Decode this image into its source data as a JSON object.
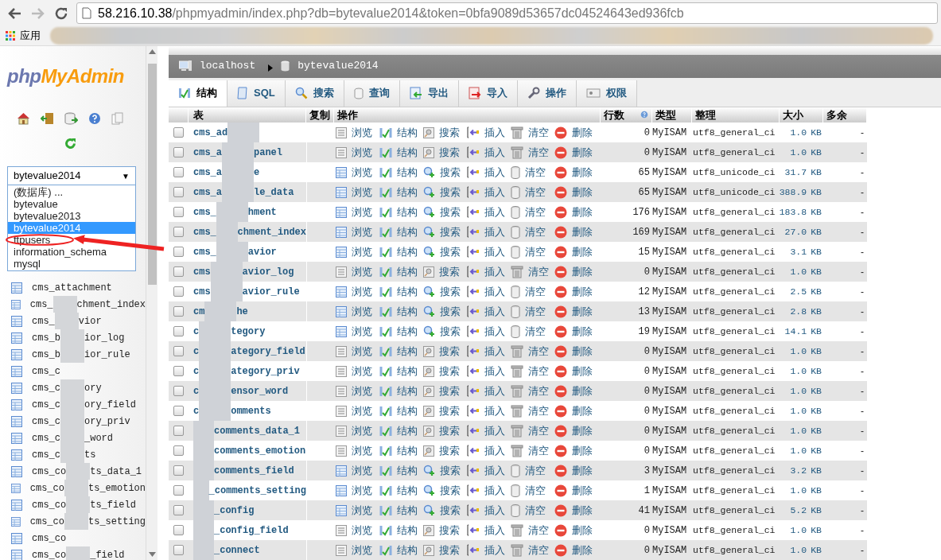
{
  "browser": {
    "url_host": "58.216.10.38",
    "url_path": "/phpmyadmin/index.php?db=bytevalue2014&token=0bfa9089d53657dc04524643ed936fcb",
    "forward_disabled": true,
    "bookmarks": [
      {
        "label": "应用"
      }
    ]
  },
  "sidebar": {
    "logo_php": "php",
    "logo_myadmin": "MyAdmin",
    "db_select": {
      "value": "bytevalue2014",
      "arrow": "▼",
      "options": [
        {
          "label": "(数据库) ...",
          "selected": false
        },
        {
          "label": "bytevalue",
          "selected": false
        },
        {
          "label": "bytevalue2013",
          "selected": false
        },
        {
          "label": "bytevalue2014",
          "selected": true
        },
        {
          "label": "ftpusers",
          "selected": false
        },
        {
          "label": "information_schema",
          "selected": false
        },
        {
          "label": "mysql",
          "selected": false
        }
      ]
    },
    "tables": [
      {
        "name_start": "cms_attachment"
      },
      {
        "name_start": "cms_",
        "name_end": "chment_index"
      },
      {
        "name_start": "cms_",
        "name_end": "vior"
      },
      {
        "name_start": "cms_b",
        "name_end": "ior_log"
      },
      {
        "name_start": "cms_b",
        "name_end": "ior_rule"
      },
      {
        "name_start": "cms_c"
      },
      {
        "name_start": "cms_c",
        "name_end": "ory"
      },
      {
        "name_start": "cms_c",
        "name_end": "ory_field"
      },
      {
        "name_start": "cms_c",
        "name_end": "ory_priv"
      },
      {
        "name_start": "cms_c",
        "name_end": "_word"
      },
      {
        "name_start": "cms_c",
        "name_end": "ts"
      },
      {
        "name_start": "cms_co",
        "name_end": "ts_data_1"
      },
      {
        "name_start": "cms_co",
        "name_end": "ts_emotion"
      },
      {
        "name_start": "cms_co",
        "name_end": "ts_field"
      },
      {
        "name_start": "cms_co",
        "name_end": "ts_setting"
      },
      {
        "name_start": "cms_co"
      },
      {
        "name_start": "cms_co",
        "name_end": "_field"
      }
    ]
  },
  "breadcrumb": [
    {
      "label": "localhost",
      "kind": "server"
    },
    {
      "label": "bytevalue2014",
      "kind": "database"
    }
  ],
  "tabs": [
    {
      "label": "结构",
      "selected": true
    },
    {
      "label": "SQL",
      "selected": false
    },
    {
      "label": "搜索",
      "selected": false
    },
    {
      "label": "查询",
      "selected": false
    },
    {
      "label": "导出",
      "selected": false
    },
    {
      "label": "导入",
      "selected": false
    },
    {
      "label": "操作",
      "selected": false
    },
    {
      "label": "权限",
      "selected": false
    }
  ],
  "table": {
    "columns": [
      "表",
      "复制",
      "操作",
      "行数",
      "类型",
      "整理",
      "大小",
      "多余"
    ],
    "rows": [
      {
        "checked": false,
        "name_start": "cms_ad",
        "actions": [
          "浏览",
          "结构",
          "搜索",
          "插入",
          "清空",
          "删除"
        ],
        "empty": true,
        "rows": "0",
        "engine": "MyISAM",
        "collation": "utf8_general_ci",
        "size": "1.0",
        "unit": "KB",
        "overhead": "-"
      },
      {
        "checked": false,
        "name_start": "cms_a",
        "name_end": "panel",
        "actions": [
          "浏览",
          "结构",
          "搜索",
          "插入",
          "清空",
          "删除"
        ],
        "empty": true,
        "rows": "0",
        "engine": "MyISAM",
        "collation": "utf8_general_ci",
        "size": "1.0",
        "unit": "KB",
        "overhead": "-"
      },
      {
        "checked": false,
        "name_start": "cms_a",
        "name_end": "e",
        "actions": [
          "浏览",
          "结构",
          "搜索",
          "插入",
          "清空",
          "删除"
        ],
        "empty": false,
        "rows": "65",
        "engine": "MyISAM",
        "collation": "utf8_unicode_ci",
        "size": "31.7",
        "unit": "KB",
        "overhead": "-"
      },
      {
        "checked": false,
        "name_start": "cms_a",
        "name_end": "le_data",
        "actions": [
          "浏览",
          "结构",
          "搜索",
          "插入",
          "清空",
          "删除"
        ],
        "empty": false,
        "rows": "65",
        "engine": "MyISAM",
        "collation": "utf8_unicode_ci",
        "size": "388.9",
        "unit": "KB",
        "overhead": "-"
      },
      {
        "checked": false,
        "name_start": "cms_",
        "name_end": "hment",
        "actions": [
          "浏览",
          "结构",
          "搜索",
          "插入",
          "清空",
          "删除"
        ],
        "empty": false,
        "rows": "176",
        "engine": "MyISAM",
        "collation": "utf8_general_ci",
        "size": "183.8",
        "unit": "KB",
        "overhead": "-"
      },
      {
        "checked": false,
        "name_start": "cms_",
        "name_end": "chment_index",
        "actions": [
          "浏览",
          "结构",
          "搜索",
          "插入",
          "清空",
          "删除"
        ],
        "empty": false,
        "rows": "169",
        "engine": "MyISAM",
        "collation": "utf8_general_ci",
        "size": "27.0",
        "unit": "KB",
        "overhead": "-"
      },
      {
        "checked": false,
        "name_start": "cms_",
        "name_end": "avior",
        "actions": [
          "浏览",
          "结构",
          "搜索",
          "插入",
          "清空",
          "删除"
        ],
        "empty": false,
        "rows": "15",
        "engine": "MyISAM",
        "collation": "utf8_general_ci",
        "size": "3.1",
        "unit": "KB",
        "overhead": "-"
      },
      {
        "checked": false,
        "name_start": "cms",
        "name_end": "avior_log",
        "actions": [
          "浏览",
          "结构",
          "搜索",
          "插入",
          "清空",
          "删除"
        ],
        "empty": true,
        "rows": "0",
        "engine": "MyISAM",
        "collation": "utf8_general_ci",
        "size": "1.0",
        "unit": "KB",
        "overhead": "-"
      },
      {
        "checked": false,
        "name_start": "cms",
        "name_end": "avior_rule",
        "actions": [
          "浏览",
          "结构",
          "搜索",
          "插入",
          "清空",
          "删除"
        ],
        "empty": false,
        "rows": "12",
        "engine": "MyISAM",
        "collation": "utf8_general_ci",
        "size": "2.5",
        "unit": "KB",
        "overhead": "-"
      },
      {
        "checked": false,
        "name_start": "cm",
        "name_end": "he",
        "actions": [
          "浏览",
          "结构",
          "搜索",
          "插入",
          "清空",
          "删除"
        ],
        "empty": false,
        "rows": "13",
        "engine": "MyISAM",
        "collation": "utf8_general_ci",
        "size": "2.8",
        "unit": "KB",
        "overhead": "-"
      },
      {
        "checked": false,
        "name_start": "c",
        "name_end": "tegory",
        "actions": [
          "浏览",
          "结构",
          "搜索",
          "插入",
          "清空",
          "删除"
        ],
        "empty": false,
        "rows": "19",
        "engine": "MyISAM",
        "collation": "utf8_general_ci",
        "size": "14.1",
        "unit": "KB",
        "overhead": "-"
      },
      {
        "checked": false,
        "name_start": "c",
        "name_end": "ategory_field",
        "actions": [
          "浏览",
          "结构",
          "搜索",
          "插入",
          "清空",
          "删除"
        ],
        "empty": true,
        "rows": "0",
        "engine": "MyISAM",
        "collation": "utf8_general_ci",
        "size": "1.0",
        "unit": "KB",
        "overhead": "-"
      },
      {
        "checked": false,
        "name_start": "c",
        "name_end": "ategory_priv",
        "actions": [
          "浏览",
          "结构",
          "搜索",
          "插入",
          "清空",
          "删除"
        ],
        "empty": true,
        "rows": "0",
        "engine": "MyISAM",
        "collation": "utf8_general_ci",
        "size": "1.0",
        "unit": "KB",
        "overhead": "-"
      },
      {
        "checked": false,
        "name_start": "c",
        "name_end": "ensor_word",
        "actions": [
          "浏览",
          "结构",
          "搜索",
          "插入",
          "清空",
          "删除"
        ],
        "empty": true,
        "rows": "0",
        "engine": "MyISAM",
        "collation": "utf8_general_ci",
        "size": "1.0",
        "unit": "KB",
        "overhead": "-"
      },
      {
        "checked": false,
        "name_start": "c",
        "name_end": "omments",
        "actions": [
          "浏览",
          "结构",
          "搜索",
          "插入",
          "清空",
          "删除"
        ],
        "empty": true,
        "rows": "0",
        "engine": "MyISAM",
        "collation": "utf8_general_ci",
        "size": "1.0",
        "unit": "KB",
        "overhead": "-"
      },
      {
        "checked": false,
        "name_end": "comments_data_1",
        "actions": [
          "浏览",
          "结构",
          "搜索",
          "插入",
          "清空",
          "删除"
        ],
        "empty": true,
        "rows": "0",
        "engine": "MyISAM",
        "collation": "utf8_general_ci",
        "size": "1.0",
        "unit": "KB",
        "overhead": "-"
      },
      {
        "checked": false,
        "name_end": "comments_emotion",
        "actions": [
          "浏览",
          "结构",
          "搜索",
          "插入",
          "清空",
          "删除"
        ],
        "empty": true,
        "rows": "0",
        "engine": "MyISAM",
        "collation": "utf8_general_ci",
        "size": "1.0",
        "unit": "KB",
        "overhead": "-"
      },
      {
        "checked": false,
        "name_end": "comments_field",
        "actions": [
          "浏览",
          "结构",
          "搜索",
          "插入",
          "清空",
          "删除"
        ],
        "empty": false,
        "rows": "3",
        "engine": "MyISAM",
        "collation": "utf8_general_ci",
        "size": "3.2",
        "unit": "KB",
        "overhead": "-"
      },
      {
        "checked": false,
        "name_end": "_comments_setting",
        "actions": [
          "浏览",
          "结构",
          "搜索",
          "插入",
          "清空",
          "删除"
        ],
        "empty": false,
        "rows": "1",
        "engine": "MyISAM",
        "collation": "utf8_general_ci",
        "size": "1.0",
        "unit": "KB",
        "overhead": "-"
      },
      {
        "checked": false,
        "name_end": "_config",
        "actions": [
          "浏览",
          "结构",
          "搜索",
          "插入",
          "清空",
          "删除"
        ],
        "empty": false,
        "rows": "41",
        "engine": "MyISAM",
        "collation": "utf8_general_ci",
        "size": "5.2",
        "unit": "KB",
        "overhead": "-"
      },
      {
        "checked": false,
        "name_end": "_config_field",
        "actions": [
          "浏览",
          "结构",
          "搜索",
          "插入",
          "清空",
          "删除"
        ],
        "empty": true,
        "rows": "0",
        "engine": "MyISAM",
        "collation": "utf8_general_ci",
        "size": "1.0",
        "unit": "KB",
        "overhead": "-"
      },
      {
        "checked": false,
        "name_end": "_connect",
        "actions": [
          "浏览",
          "结构",
          "搜索",
          "插入",
          "清空",
          "删除"
        ],
        "empty": true,
        "rows": "0",
        "engine": "MyISAM",
        "collation": "utf8_general_ci",
        "size": "1.0",
        "unit": "KB",
        "overhead": "-"
      }
    ]
  }
}
